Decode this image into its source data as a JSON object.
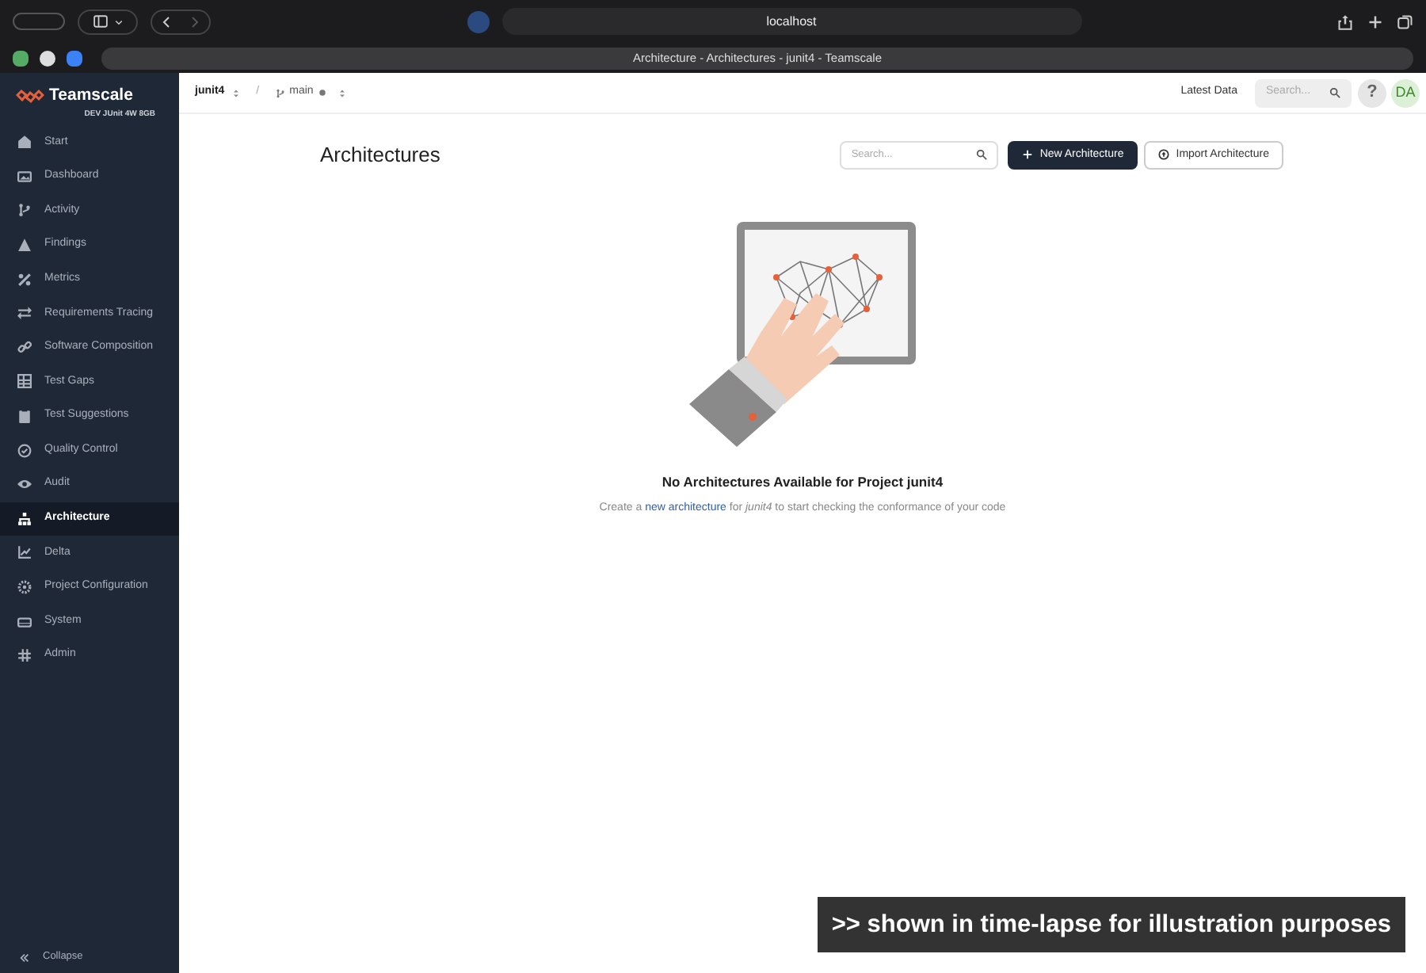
{
  "browser": {
    "address": "localhost",
    "tab_title": "Architecture - Architectures - junit4 - Teamscale"
  },
  "sidebar": {
    "logo": "Teamscale",
    "subtitle": "DEV JUnit 4W 8GB",
    "items": [
      {
        "label": "Start",
        "selected": false
      },
      {
        "label": "Dashboard",
        "selected": false
      },
      {
        "label": "Activity",
        "selected": false
      },
      {
        "label": "Findings",
        "selected": false
      },
      {
        "label": "Metrics",
        "selected": false
      },
      {
        "label": "Requirements Tracing",
        "selected": false
      },
      {
        "label": "Software Composition",
        "selected": false
      },
      {
        "label": "Test Gaps",
        "selected": false
      },
      {
        "label": "Test Suggestions",
        "selected": false
      },
      {
        "label": "Quality Control",
        "selected": false
      },
      {
        "label": "Audit",
        "selected": false
      },
      {
        "label": "Architecture",
        "selected": true
      },
      {
        "label": "Delta",
        "selected": false
      },
      {
        "label": "Project Configuration",
        "selected": false
      },
      {
        "label": "System",
        "selected": false
      },
      {
        "label": "Admin",
        "selected": false
      }
    ],
    "collapse": "Collapse"
  },
  "topbar": {
    "project": "junit4",
    "separator": "/",
    "branch": "main",
    "latest_data": "Latest Data",
    "search_placeholder": "Search...",
    "help": "?",
    "avatar": "DA"
  },
  "page": {
    "title": "Architectures",
    "search_placeholder": "Search...",
    "new_button": "New Architecture",
    "import_button": "Import Architecture"
  },
  "empty_state": {
    "heading": "No Architectures Available for Project junit4",
    "text_start": "Create a",
    "link": "new architecture",
    "text_end": "for *junit4* to start checking the conformance of your code"
  },
  "overlay_caption": ">> shown in time-lapse for illustration purposes"
}
